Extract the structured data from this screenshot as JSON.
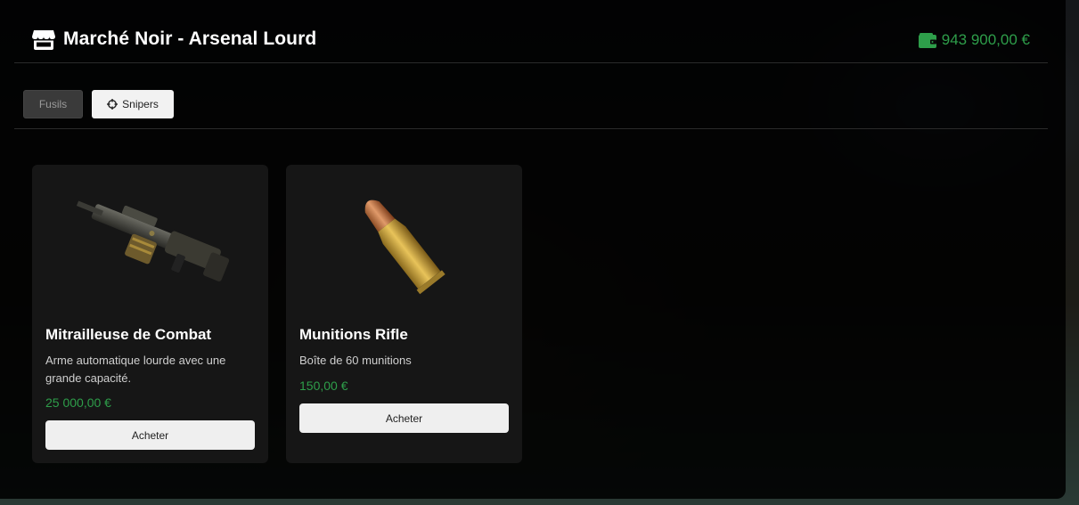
{
  "header": {
    "title": "Marché Noir - Arsenal Lourd",
    "store_icon": "store-icon",
    "balance": "943 900,00 €",
    "wallet_icon": "wallet-icon"
  },
  "tabs": [
    {
      "label": "Fusils",
      "active": false
    },
    {
      "label": "Snipers",
      "icon": "crosshair-icon",
      "active": true
    }
  ],
  "products": [
    {
      "name": "Mitrailleuse de Combat",
      "description": "Arme automatique lourde avec une grande capacité.",
      "price": "25 000,00 €",
      "buy_label": "Acheter",
      "image": "machine-gun-image"
    },
    {
      "name": "Munitions Rifle",
      "description": "Boîte de 60 munitions",
      "price": "150,00 €",
      "buy_label": "Acheter",
      "image": "rifle-bullet-image"
    }
  ],
  "colors": {
    "accent_green": "#2e9e4a",
    "panel_bg": "#000000",
    "card_bg": "#161616"
  }
}
